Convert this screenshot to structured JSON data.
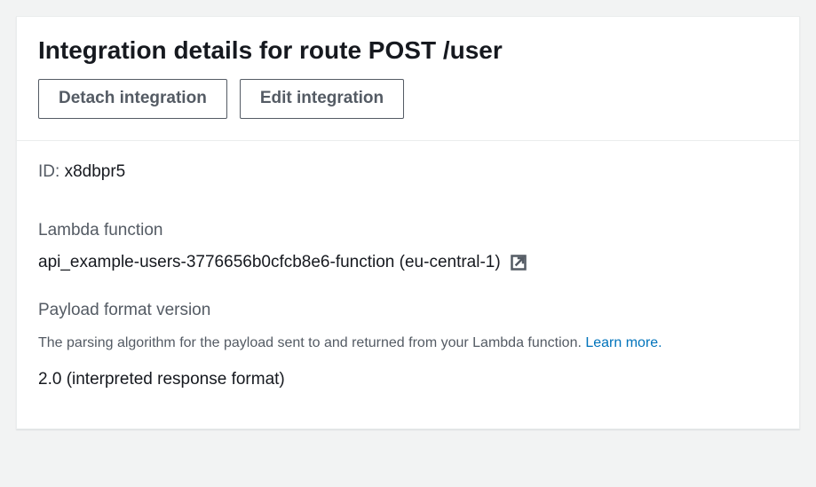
{
  "header": {
    "title": "Integration details for route POST /user",
    "detach_label": "Detach integration",
    "edit_label": "Edit integration"
  },
  "id": {
    "label": "ID:",
    "value": "x8dbpr5"
  },
  "lambda": {
    "label": "Lambda function",
    "value": "api_example-users-3776656b0cfcb8e6-function (eu-central-1)"
  },
  "payload": {
    "label": "Payload format version",
    "description": "The parsing algorithm for the payload sent to and returned from your Lambda function. ",
    "learn_more": "Learn more.",
    "value": "2.0 (interpreted response format)"
  }
}
